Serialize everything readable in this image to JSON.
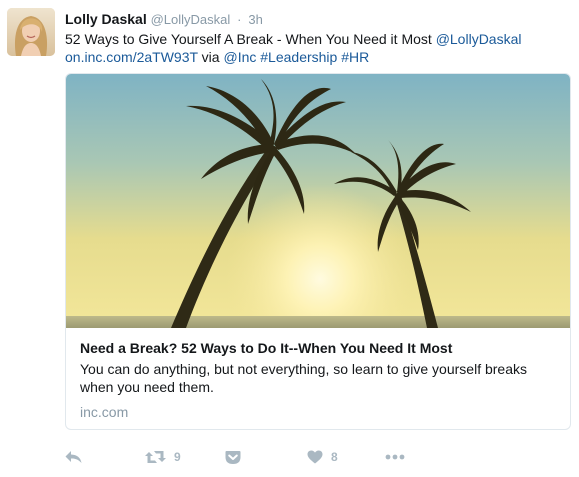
{
  "tweet": {
    "author_name": "Lolly Daskal",
    "author_handle": "@LollyDaskal",
    "separator": "·",
    "timestamp": "3h",
    "text_main": "52 Ways to Give Yourself A Break - When You Need it Most ",
    "text_mention": "@LollyDaskal",
    "text_link": "on.inc.com/2aTW93T",
    "text_via": " via ",
    "text_mention_inc": "@Inc",
    "text_hashtag_leadership": "#Leadership",
    "text_hashtag_hr": "#HR"
  },
  "card": {
    "title": "Need a Break? 52 Ways to Do It--When You Need It Most",
    "description": "You can do anything, but not everything, so learn to give yourself breaks when you need them.",
    "domain": "inc.com"
  },
  "actions": {
    "retweet_count": "9",
    "like_count": "8"
  },
  "icons": {
    "reply": "reply-icon",
    "retweet": "retweet-icon",
    "pocket": "pocket-icon",
    "like": "heart-icon",
    "more": "more-icon"
  },
  "colors": {
    "link": "#1b5a99",
    "muted": "#8899a6",
    "action": "#aab8c2",
    "text": "#14171a"
  }
}
